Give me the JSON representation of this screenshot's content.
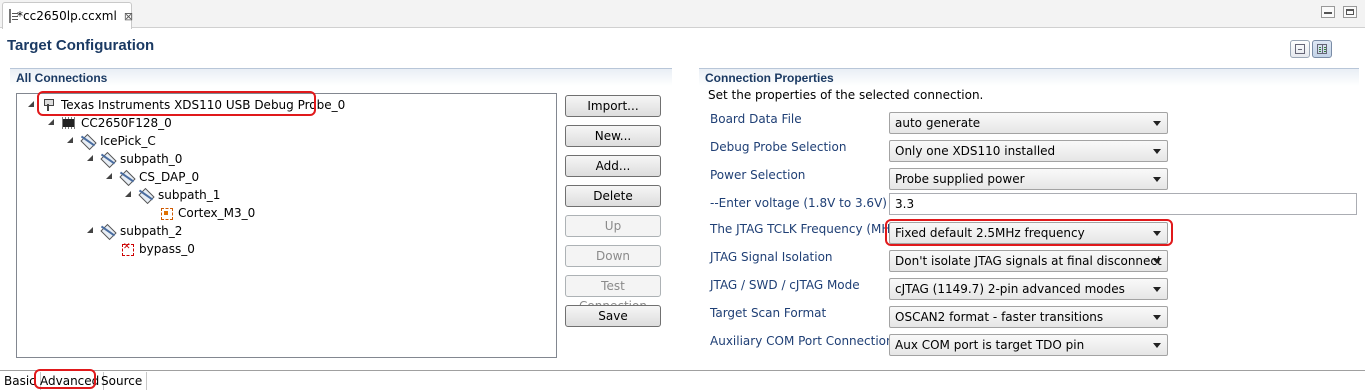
{
  "editor": {
    "tab_title": "*cc2650lp.ccxml",
    "close_glyph": "⊠"
  },
  "page_title": "Target Configuration",
  "connections": {
    "header": "All Connections",
    "tree": [
      {
        "label": "Texas Instruments XDS110 USB Debug Probe_0",
        "icon": "probe-icon",
        "highlighted": true
      },
      {
        "label": "CC2650F128_0",
        "icon": "chip-icon"
      },
      {
        "label": "IcePick_C",
        "icon": "router-icon"
      },
      {
        "label": "subpath_0",
        "icon": "router-icon"
      },
      {
        "label": "CS_DAP_0",
        "icon": "router-icon"
      },
      {
        "label": "subpath_1",
        "icon": "router-icon"
      },
      {
        "label": "Cortex_M3_0",
        "icon": "cpu-icon"
      },
      {
        "label": "subpath_2",
        "icon": "router-icon"
      },
      {
        "label": "bypass_0",
        "icon": "bypass-icon"
      }
    ],
    "buttons": {
      "import": "Import...",
      "new": "New...",
      "add": "Add...",
      "delete": "Delete",
      "up": "Up",
      "down": "Down",
      "test": "Test Connection",
      "save": "Save"
    }
  },
  "properties": {
    "header": "Connection Properties",
    "description": "Set the properties of the selected connection.",
    "rows": [
      {
        "label": "Board Data File",
        "value": "auto generate"
      },
      {
        "label": "Debug Probe Selection",
        "value": "Only one XDS110 installed"
      },
      {
        "label": "Power Selection",
        "value": "Probe supplied power"
      },
      {
        "label": "--Enter voltage (1.8V to 3.6V)",
        "value": "3.3"
      },
      {
        "label": "The JTAG TCLK Frequency (MHz)",
        "value": "Fixed default 2.5MHz frequency",
        "highlighted": true
      },
      {
        "label": "JTAG Signal Isolation",
        "value": "Don't isolate JTAG signals at final disconnect"
      },
      {
        "label": "JTAG / SWD / cJTAG Mode",
        "value": "cJTAG (1149.7) 2-pin advanced modes"
      },
      {
        "label": "Target Scan Format",
        "value": "OSCAN2 format - faster transitions"
      },
      {
        "label": "Auxiliary COM Port Connection",
        "value": "Aux COM port is target TDO pin"
      }
    ]
  },
  "bottom_tabs": [
    {
      "label": "Basic"
    },
    {
      "label": "Advanced",
      "selected": true
    },
    {
      "label": "Source"
    }
  ],
  "colors": {
    "header_text": "#1b3a63",
    "label_text": "#1f3f75",
    "highlight": "#e0191b"
  }
}
